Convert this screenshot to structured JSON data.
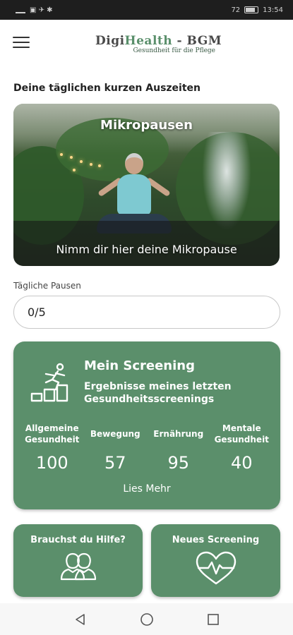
{
  "status_bar": {
    "time": "13:54",
    "battery": "72"
  },
  "header": {
    "brand_prefix": "Digi",
    "brand_highlight": "Health",
    "brand_suffix": " - BGM",
    "subtitle": "Gesundheit für die Pflege"
  },
  "section_title": "Deine täglichen kurzen Auszeiten",
  "hero": {
    "title": "Mikropausen",
    "subtitle": "Nimm dir hier deine Mikropause"
  },
  "daily_breaks": {
    "label": "Tägliche Pausen",
    "value": "0/5"
  },
  "screening": {
    "title": "Mein Screening",
    "subtitle": "Ergebnisse meines letzten Gesundheitsscreenings",
    "metrics": [
      {
        "label": "Allgemeine Gesundheit",
        "value": "100"
      },
      {
        "label": "Bewegung",
        "value": "57"
      },
      {
        "label": "Ernährung",
        "value": "95"
      },
      {
        "label": "Mentale Gesundheit",
        "value": "40"
      }
    ],
    "more_label": "Lies Mehr"
  },
  "tiles": [
    {
      "label": "Brauchst du Hilfe?",
      "icon": "people-icon"
    },
    {
      "label": "Neues Screening",
      "icon": "heart-pulse-icon"
    }
  ],
  "colors": {
    "accent": "#5b8f6b",
    "brand_green": "#5a8f6b"
  }
}
